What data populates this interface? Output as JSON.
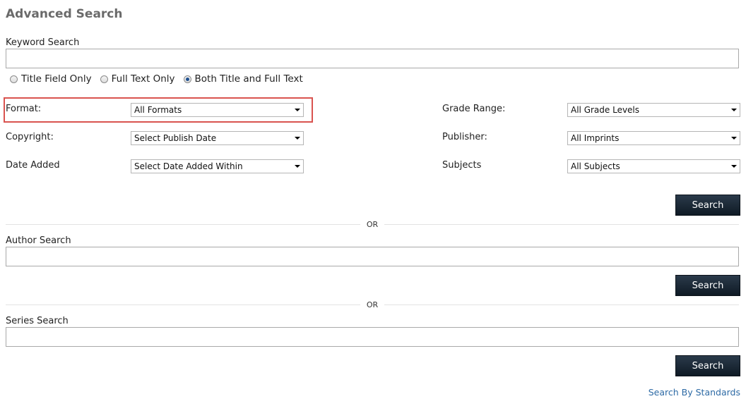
{
  "page": {
    "title": "Advanced Search"
  },
  "keyword": {
    "label": "Keyword Search",
    "value": "",
    "options": [
      {
        "label": "Title Field Only",
        "checked": false
      },
      {
        "label": "Full Text Only",
        "checked": false
      },
      {
        "label": "Both Title and Full Text",
        "checked": true
      }
    ]
  },
  "filters": {
    "format": {
      "label": "Format:",
      "value": "All Formats"
    },
    "copyright": {
      "label": "Copyright:",
      "value": "Select Publish Date"
    },
    "date_added": {
      "label": "Date Added",
      "value": "Select Date Added Within"
    },
    "grade_range": {
      "label": "Grade Range:",
      "value": "All Grade Levels"
    },
    "publisher": {
      "label": "Publisher:",
      "value": "All Imprints"
    },
    "subjects": {
      "label": "Subjects",
      "value": "All Subjects"
    }
  },
  "buttons": {
    "search_label": "Search"
  },
  "dividers": {
    "or_label": "OR"
  },
  "author": {
    "label": "Author Search",
    "value": ""
  },
  "series": {
    "label": "Series Search",
    "value": ""
  },
  "links": {
    "standards": "Search By Standards"
  },
  "colors": {
    "highlight": "#d9534f",
    "button_bg": "#1b2836",
    "link": "#2d6aa5"
  }
}
